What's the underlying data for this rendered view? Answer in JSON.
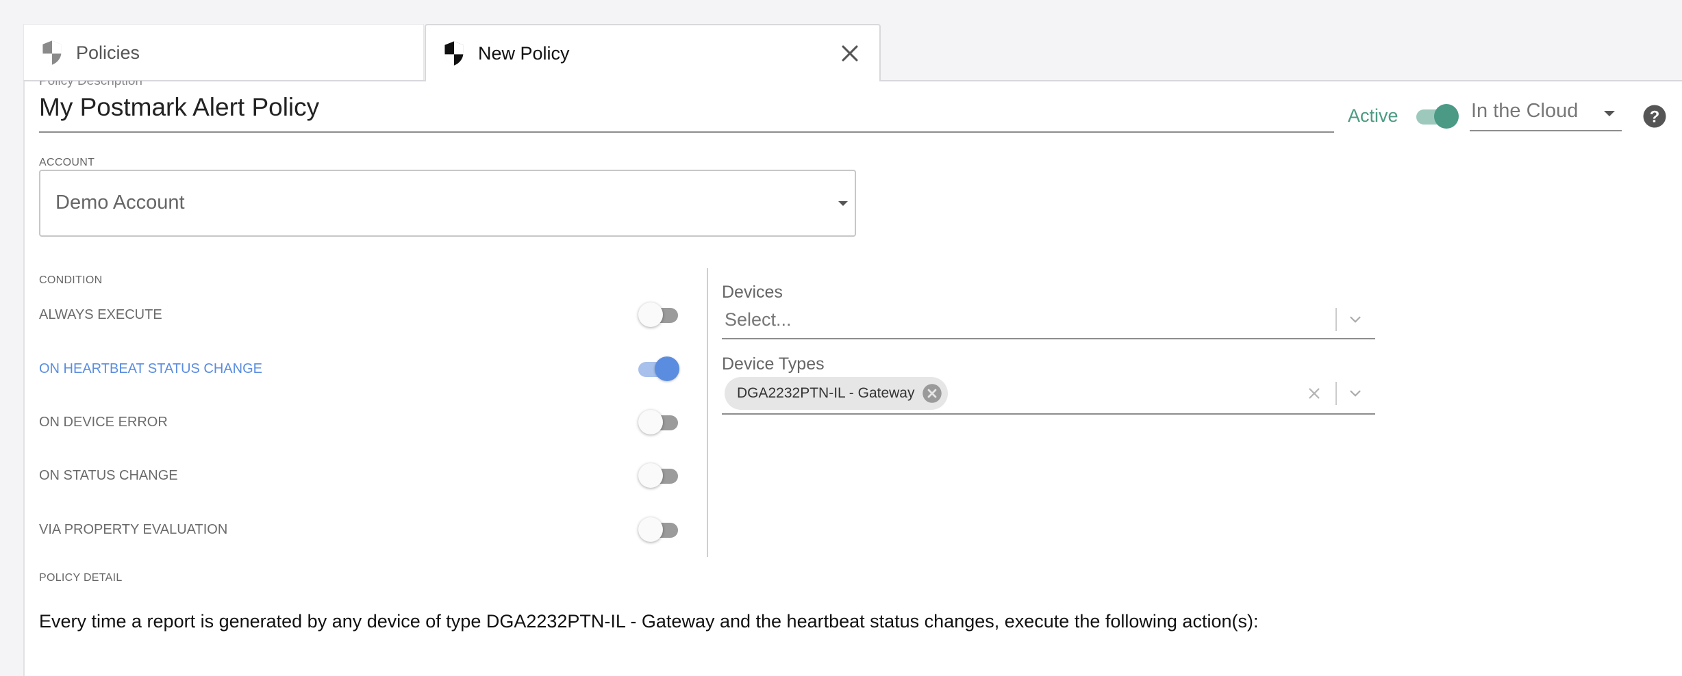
{
  "tabs": [
    {
      "label": "Policies",
      "icon": "shield-icon"
    },
    {
      "label": "New Policy",
      "icon": "shield-icon",
      "close_icon": "close-icon"
    }
  ],
  "policy": {
    "description_label": "Policy Description",
    "description_value": "My Postmark Alert Policy",
    "active_label": "Active",
    "active_state": true,
    "location_value": "In the Cloud",
    "help_icon": "help-icon"
  },
  "account": {
    "label": "ACCOUNT",
    "value": "Demo Account"
  },
  "condition": {
    "label": "CONDITION",
    "items": [
      {
        "label": "ALWAYS EXECUTE",
        "enabled": false
      },
      {
        "label": "ON HEARTBEAT STATUS CHANGE",
        "enabled": true
      },
      {
        "label": "ON DEVICE ERROR",
        "enabled": false
      },
      {
        "label": "ON STATUS CHANGE",
        "enabled": false
      },
      {
        "label": "VIA PROPERTY EVALUATION",
        "enabled": false
      }
    ]
  },
  "devices": {
    "label": "Devices",
    "placeholder": "Select..."
  },
  "device_types": {
    "label": "Device Types",
    "chips": [
      "DGA2232PTN-IL - Gateway"
    ]
  },
  "policy_detail": {
    "label": "POLICY DETAIL",
    "text": "Every time a report is generated by any device of type DGA2232PTN-IL - Gateway and the heartbeat status changes, execute the following action(s):"
  },
  "colors": {
    "accent_green": "#4a9a85",
    "accent_blue": "#5a8de0"
  }
}
